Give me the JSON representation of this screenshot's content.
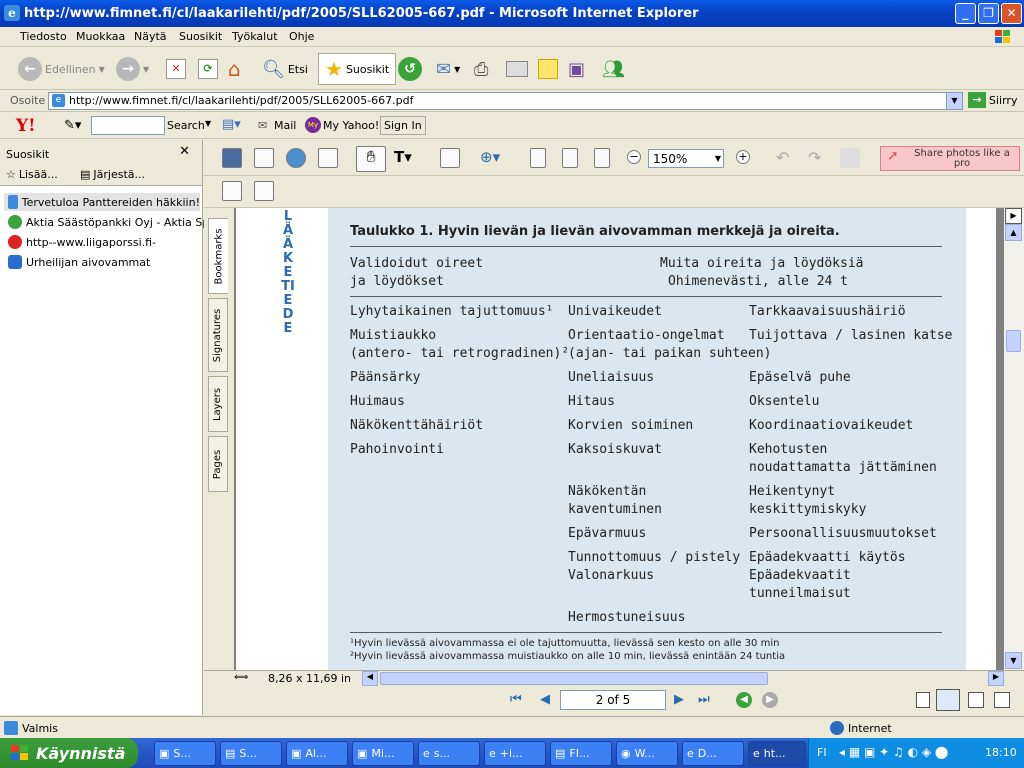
{
  "window": {
    "title": "http://www.fimnet.fi/cl/laakarilehti/pdf/2005/SLL62005-667.pdf - Microsoft Internet Explorer"
  },
  "menu": [
    "Tiedosto",
    "Muokkaa",
    "Näytä",
    "Suosikit",
    "Työkalut",
    "Ohje"
  ],
  "toolbar": {
    "back": "Edellinen",
    "search": "Etsi",
    "favorites": "Suosikit"
  },
  "address": {
    "label": "Osoite",
    "url": "http://www.fimnet.fi/cl/laakarilehti/pdf/2005/SLL62005-667.pdf",
    "go": "Siirry"
  },
  "yahoo": {
    "search": "Search",
    "mail": "Mail",
    "myyahoo": "My Yahoo!",
    "signin": "Sign In"
  },
  "sidebar": {
    "title": "Suosikit",
    "add": "Lisää...",
    "organize": "Järjestä...",
    "items": [
      "Tervetuloa Panttereiden häkkiin!",
      "Aktia Säästöpankki Oyj - Aktia Sp...",
      "http--www.liigaporssi.fi-",
      "Urheilijan aivovammat"
    ]
  },
  "pdf": {
    "zoom": "150%",
    "share": "Share photos like a pro",
    "tabs": [
      "Bookmarks",
      "Signatures",
      "Layers",
      "Pages"
    ],
    "page_size": "8,26 x 11,69 in",
    "page_nav": "2 of 5",
    "side_label": "LÄÄKETIEDE"
  },
  "table": {
    "title": "Taulukko 1. Hyvin lievän ja lievän aivovamman merkkejä ja oireita.",
    "header_left_1": "Validoidut oireet",
    "header_left_2": "ja löydökset",
    "header_right_1": "Muita oireita ja löydöksiä",
    "header_right_2": "Ohimenevästi, alle 24 t",
    "col1": [
      "Lyhytaikainen tajuttomuus¹",
      "Muistiaukko",
      "(antero- tai retrogradinen)²",
      "Päänsärky",
      "Huimaus",
      "Näkökenttähäiriöt",
      "Pahoinvointi"
    ],
    "col2": [
      "Univaikeudet",
      "Orientaatio-ongelmat",
      "(ajan- tai paikan suhteen)",
      "Uneliaisuus",
      "Hitaus",
      "Korvien soiminen",
      "Kaksoiskuvat",
      "Näkökentän",
      "kaventuminen",
      "Epävarmuus",
      "Tunnottomuus / pistely",
      "Valonarkuus",
      "Hermostuneisuus"
    ],
    "col3": [
      "Tarkkaavaisuushäiriö",
      "Tuijottava / lasinen katse",
      "Epäselvä puhe",
      "Oksentelu",
      "Koordinaatiovaikeudet",
      "Kehotusten",
      "noudattamatta jättäminen",
      "Heikentynyt",
      "keskittymiskyky",
      "Persoonallisuusmuutokset",
      "Epäadekvaatti käytös",
      "Epäadekvaatit",
      "tunneilmaisut"
    ],
    "foot1": "¹Hyvin lievässä aivovammassa ei ole tajuttomuutta, lievässä sen kesto on alle 30 min",
    "foot2": "²Hyvin lievässä aivovammassa muistiaukko on alle 10 min, lievässä enintään 24 tuntia"
  },
  "status": {
    "left": "Valmis",
    "zone": "Internet"
  },
  "taskbar": {
    "start": "Käynnistä",
    "tasks": [
      "S...",
      "S...",
      "Al...",
      "Mi...",
      "s...",
      "+i...",
      "FI...",
      "W...",
      "D...",
      "ht..."
    ],
    "lang": "FI",
    "clock": "18:10"
  }
}
